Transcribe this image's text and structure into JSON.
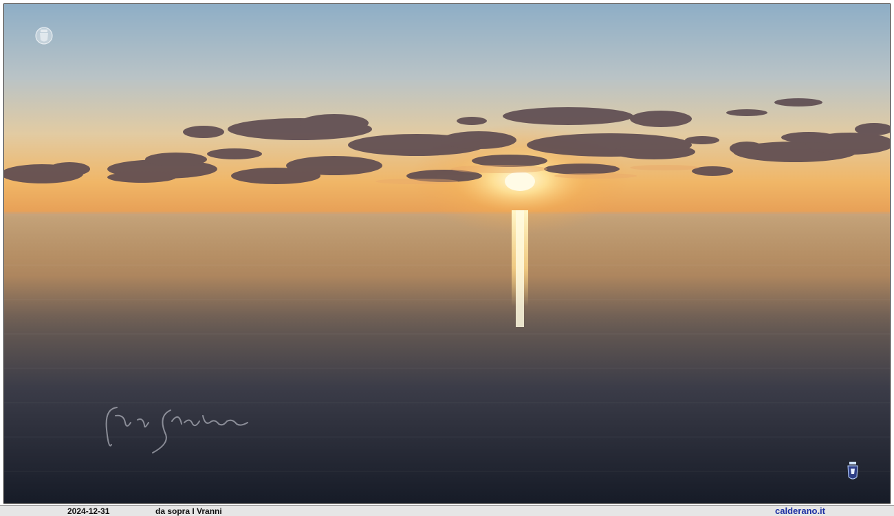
{
  "photo": {
    "subject": "sunset-over-sea",
    "colors": {
      "sky_top": "#8fb0c8",
      "sky_mid": "#d9cfb6",
      "horizon_glow": "#f2b35a",
      "sun": "#fff3c0",
      "sea_near": "#1e2330",
      "sea_far": "#c49a6a",
      "clouds": "#5a4a52"
    },
    "signature_text": "Calderano",
    "logos": [
      "crest-icon",
      "knight-icon"
    ]
  },
  "footer": {
    "date": "2024-12-31",
    "caption": "da sopra I Vranni",
    "site": "calderano.it",
    "site_color": "#1c2fa3"
  }
}
